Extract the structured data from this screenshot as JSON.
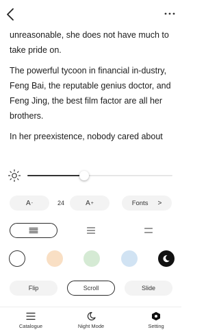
{
  "reader": {
    "paragraphs": [
      "unreasonable, she does not have much to take pride on.",
      "The powerful tycoon in financial in-dustry, Feng Bai, the reputable genius doctor, and Feng Jing, the best film factor are all her brothers.",
      "In her preexistence, nobody cared about"
    ]
  },
  "brightness": {
    "level": 0.39
  },
  "font_settings": {
    "decrease_label": "A",
    "decrease_mark": "-",
    "size": "24",
    "increase_label": "A",
    "increase_mark": "+",
    "fonts_label": "Fonts",
    "fonts_chevron": ">"
  },
  "line_spacing": {
    "options": [
      "compact",
      "normal",
      "loose"
    ],
    "selected": "compact"
  },
  "themes": {
    "colors": [
      "#ffffff",
      "#f9dfc4",
      "#d5ead4",
      "#d1e3f3",
      "#111111"
    ],
    "selected_index": 4
  },
  "page_mode": {
    "options": [
      "Flip",
      "Scroll",
      "Slide"
    ],
    "selected": "Scroll"
  },
  "bottom_nav": {
    "catalogue": "Catalogue",
    "night_mode": "Night Mode",
    "setting": "Setting"
  }
}
